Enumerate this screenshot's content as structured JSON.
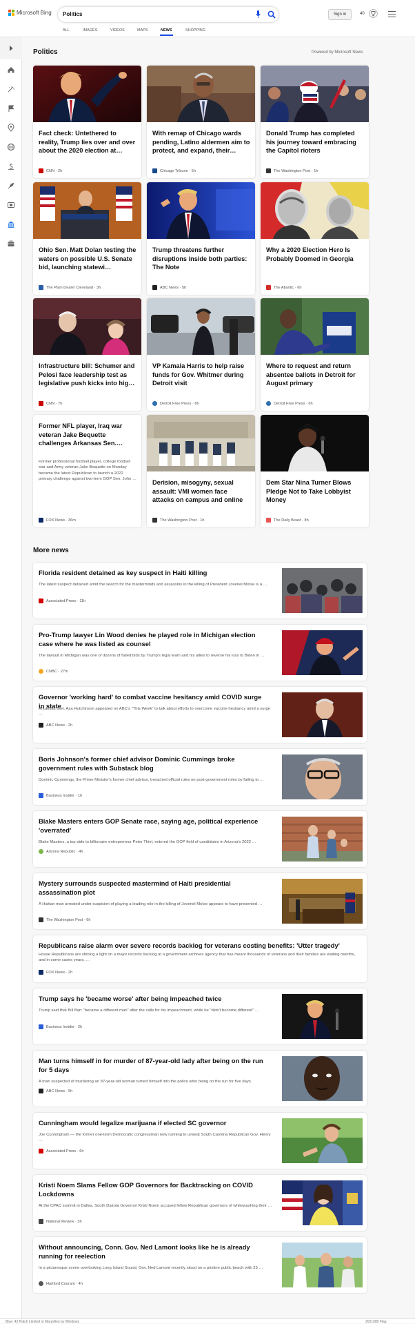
{
  "header": {
    "logo_text": "Microsoft Bing",
    "search_query": "Politics",
    "signin_label": "Sign in",
    "reward_points": "40"
  },
  "tabs": [
    {
      "label": "ALL"
    },
    {
      "label": "IMAGES"
    },
    {
      "label": "VIDEOS"
    },
    {
      "label": "MAPS"
    },
    {
      "label": "NEWS",
      "active": true
    },
    {
      "label": "SHOPPING"
    }
  ],
  "rail_icons": [
    "expand-chevron-icon",
    "home-icon",
    "ai-sparkle-icon",
    "flag-icon",
    "location-pin-icon",
    "globe-icon",
    "money-icon",
    "science-rocket-icon",
    "film-icon",
    "politics-building-icon",
    "briefcase-icon"
  ],
  "section": {
    "title": "Politics",
    "powered_by": "Powered by Microsoft News"
  },
  "top_cards": [
    {
      "title": "Fact check: Untethered to reality, Trump lies over and over about the 2020 election at…",
      "source": "CNN",
      "time": "2h",
      "color": "#cc0000"
    },
    {
      "title": "With remap of Chicago wards pending, Latino aldermen aim to protect, and expand, their…",
      "source": "Chicago Tribune",
      "time": "5h",
      "color": "#1a4b8c"
    },
    {
      "title": "Donald Trump has completed his journey toward embracing the Capitol rioters",
      "source": "The Washington Post",
      "time": "1h",
      "color": "#333333"
    },
    {
      "title": "Ohio Sen. Matt Dolan testing the waters on possible U.S. Senate bid, launching statewi…",
      "source": "The Plain Dealer Cleveland",
      "time": "3h",
      "color": "#2a5ea8"
    },
    {
      "title": "Trump threatens further disruptions inside both parties: The Note",
      "source": "ABC News",
      "time": "5h",
      "color": "#222222"
    },
    {
      "title": "Why a 2020 Election Hero Is Probably Doomed in Georgia",
      "source": "The Atlantic",
      "time": "6h",
      "color": "#d22f27"
    },
    {
      "title": "Infrastructure bill: Schumer and Pelosi face leadership test as legislative push kicks into hig…",
      "source": "CNN",
      "time": "7h",
      "color": "#cc0000"
    },
    {
      "title": "VP Kamala Harris to help raise funds for Gov. Whitmer during Detroit visit",
      "source": "Detroit Free Press",
      "time": "6h",
      "color": "#2f6fb0"
    },
    {
      "title": "Where to request and return absentee ballots in Detroit for August primary",
      "source": "Detroit Free Press",
      "time": "6h",
      "color": "#2f6fb0"
    },
    {
      "title": "Former NFL player, Iraq war veteran Jake Bequette challenges Arkansas Sen.…",
      "snippet": "Former professional football player, college football star and Army veteran Jake Bequette on Monday became the latest Republican to launch a 2022 primary challenge against two-term GOP Sen. John …",
      "source": "FOX News",
      "time": "36m",
      "color": "#0b2a66"
    },
    {
      "title": "Derision, misogyny, sexual assault: VMI women face attacks on campus and online",
      "source": "The Washington Post",
      "time": "1h",
      "color": "#333333"
    },
    {
      "title": "Dem Star Nina Turner Blows Pledge Not to Take Lobbyist Money",
      "source": "The Daily Beast",
      "time": "8h",
      "color": "#e85555"
    }
  ],
  "more_news": {
    "title": "More news",
    "items": [
      {
        "title": "Florida resident detained as key suspect in Haiti killing",
        "snippet": "The latest suspect detained amid the search for the masterminds and assassins in the killing of President Jovenel Moïse is a …",
        "source": "Associated Press",
        "time": "11h",
        "color": "#d40000"
      },
      {
        "title": "Pro-Trump lawyer Lin Wood denies he played role in Michigan election case where he was listed as counsel",
        "snippet": "The lawsuit in Michigan was one of dozens of failed bids by Trump's legal team and his allies to reverse his loss to Biden in …",
        "source": "CNBC",
        "time": "27m",
        "color": "#f5a623"
      },
      {
        "title": "Governor 'working hard' to combat vaccine hesitancy amid COVID surge in state",
        "snippet": "Arkansas Gov. Asa Hutchinson appeared on ABC's \"This Week\" to talk about efforts to overcome vaccine hesitancy amid a surge …",
        "source": "ABC News",
        "time": "2h",
        "color": "#222222"
      },
      {
        "title": "Boris Johnson's former chief advisor Dominic Cummings broke government rules with Substack blog",
        "snippet": "Dominic Cummings, the Prime Minister's former chief advisor, breached official rules on post-government roles by failing to …",
        "source": "Business Insider",
        "time": "1h",
        "color": "#2b5fd9"
      },
      {
        "title": "Blake Masters enters GOP Senate race, saying age, political experience 'overrated'",
        "snippet": "Blake Masters, a top aide to billionaire entrepreneur Peter Thiel, entered the GOP field of candidates in Arizona's 2022 …",
        "source": "Arizona Republic",
        "time": "4h",
        "color": "#7ab648"
      },
      {
        "title": "Mystery surrounds suspected mastermind of Haiti presidential assassination plot",
        "snippet": "A Haitian man arrested under suspicion of playing a leading role in the killing of Jovenel Moïse appears to have presented …",
        "source": "The Washington Post",
        "time": "6h",
        "color": "#333333"
      },
      {
        "title": "Republicans raise alarm over severe records backlog for veterans costing benefits: 'Utter tragedy'",
        "snippet": "House Republicans are shining a light on a major records backlog at a government archives agency that has meant thousands of veterans and their families are waiting months, and in some cases years, …",
        "source": "FOX News",
        "time": "2h",
        "color": "#0b2a66"
      },
      {
        "title": "Trump says he 'became worse' after being impeached twice",
        "snippet": "Trump said that Bill Barr \"became a different man\" after the calls for his impeachment, while he \"didn't become different\" …",
        "source": "Business Insider",
        "time": "2h",
        "color": "#2b5fd9"
      },
      {
        "title": "Man turns himself in for murder of 87-year-old lady after being on the run for 5 days",
        "snippet": "A man suspected of murdering an 87-year-old woman turned himself into the police after being on the run for five days.",
        "source": "ABC News",
        "time": "5h",
        "color": "#222222"
      },
      {
        "title": "Cunningham would legalize marijuana if elected SC governor",
        "snippet": "Joe Cunningham — the former one-term Democratic congressman now running to unseat South Carolina Republican Gov. Henry …",
        "source": "Associated Press",
        "time": "6h",
        "color": "#d40000"
      },
      {
        "title": "Kristi Noem Slams Fellow GOP Governors for Backtracking on COVID Lockdowns",
        "snippet": "At the CPAC summit in Dallas, South Dakota Governor Kristi Noem accused fellow Republican governors of whitewashing their …",
        "source": "National Review",
        "time": "3h",
        "color": "#444444"
      },
      {
        "title": "Without announcing, Conn. Gov. Ned Lamont looks like he is already running for reelection",
        "snippet": "In a picturesque scene overlooking Long Island Sound, Gov. Ned Lamont recently stood on a pristine public beach with 25 …",
        "source": "Hartford Courant",
        "time": "4h",
        "color": "#555555"
      }
    ]
  },
  "status_bar": {
    "left": "Blue: 42 Patch Limited to Maryellen by Windows",
    "right": "2021/08/ Flag"
  }
}
